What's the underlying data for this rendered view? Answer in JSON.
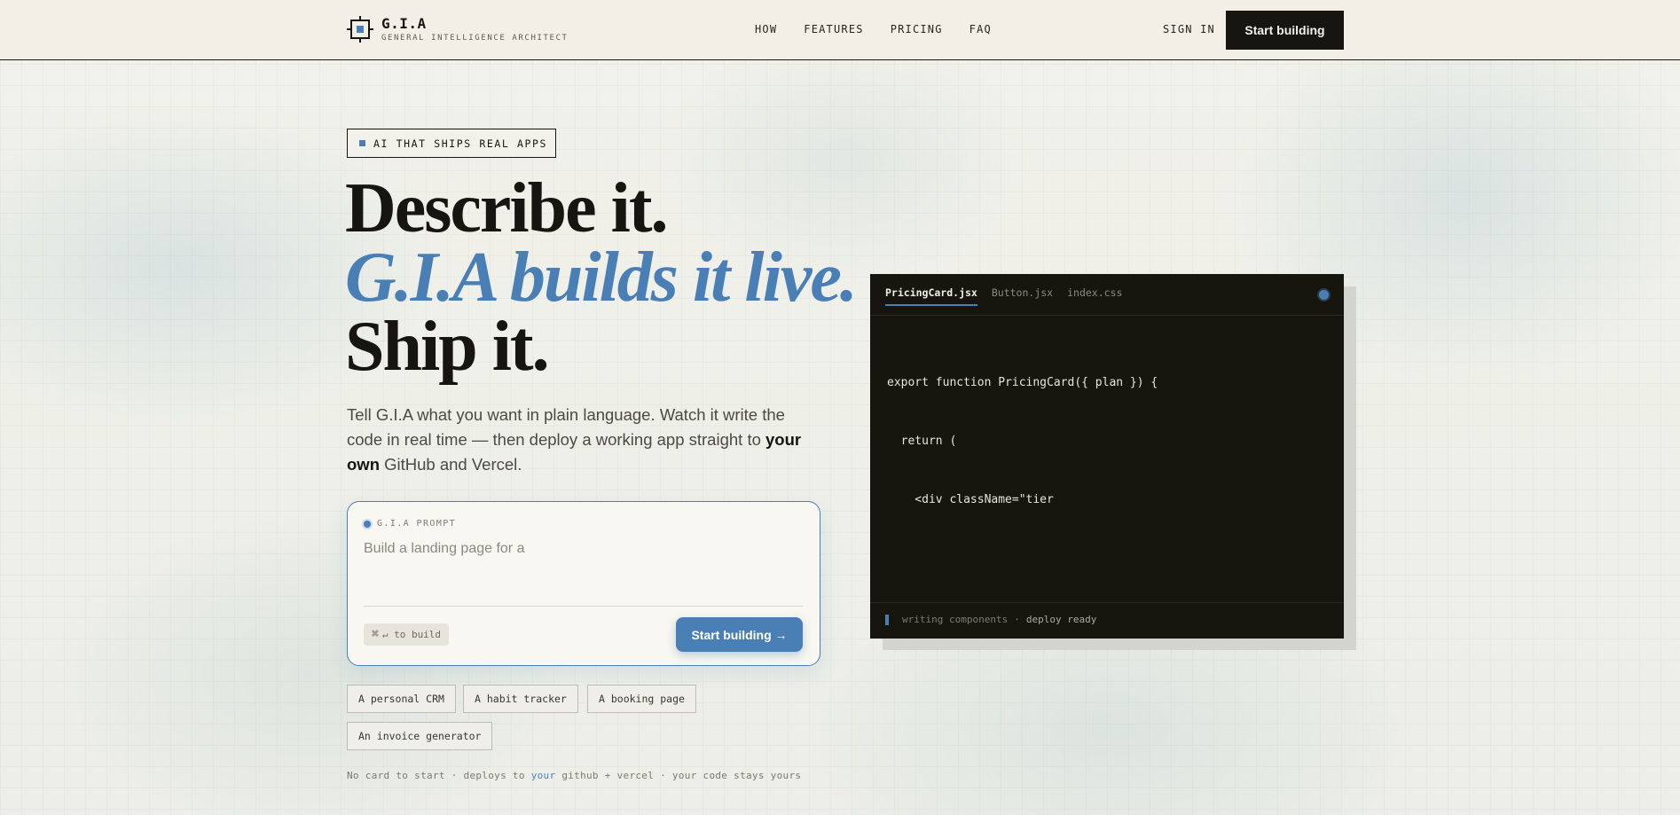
{
  "brand": {
    "name": "G.I.A",
    "tagline": "GENERAL INTELLIGENCE ARCHITECT",
    "logo_icon": "crosshair-square-logo"
  },
  "nav": {
    "items": [
      "HOW",
      "FEATURES",
      "PRICING",
      "FAQ"
    ],
    "sign_in": "SIGN IN",
    "cta": "Start building"
  },
  "hero": {
    "badge": "AI THAT SHIPS REAL APPS",
    "headline_line1": "Describe it.",
    "headline_line2": "G.I.A builds it live.",
    "headline_line3": "Ship it.",
    "lede_part1": "Tell G.I.A what you want in plain language. Watch it write the code in real time — then deploy a working app straight to ",
    "lede_bold": "your own",
    "lede_part2": " GitHub and Vercel."
  },
  "prompt": {
    "label": "G.I.A PROMPT",
    "placeholder": "Build a landing page for a",
    "shortcut_key": "⌘",
    "shortcut_text": "↵ to build",
    "submit_label": "Start building →"
  },
  "suggestions": [
    "A personal CRM",
    "A habit tracker",
    "A booking page",
    "An invoice generator"
  ],
  "footnote": {
    "part1": "No card to start · deploys to ",
    "highlight": "your",
    "part2": " github + vercel · your code stays yours"
  },
  "editor": {
    "tabs": [
      "PricingCard.jsx",
      "Button.jsx",
      "index.css"
    ],
    "active_tab": "PricingCard.jsx",
    "code_lines": [
      "export function PricingCard({ plan }) {",
      "  return (",
      "    <div className=\"tier"
    ],
    "status_left": "writing components",
    "status_sep": "·",
    "status_right": "deploy ready"
  },
  "colors": {
    "accent": "#4a7fb5",
    "ink": "#16150f",
    "paper": "#f2efe7"
  }
}
